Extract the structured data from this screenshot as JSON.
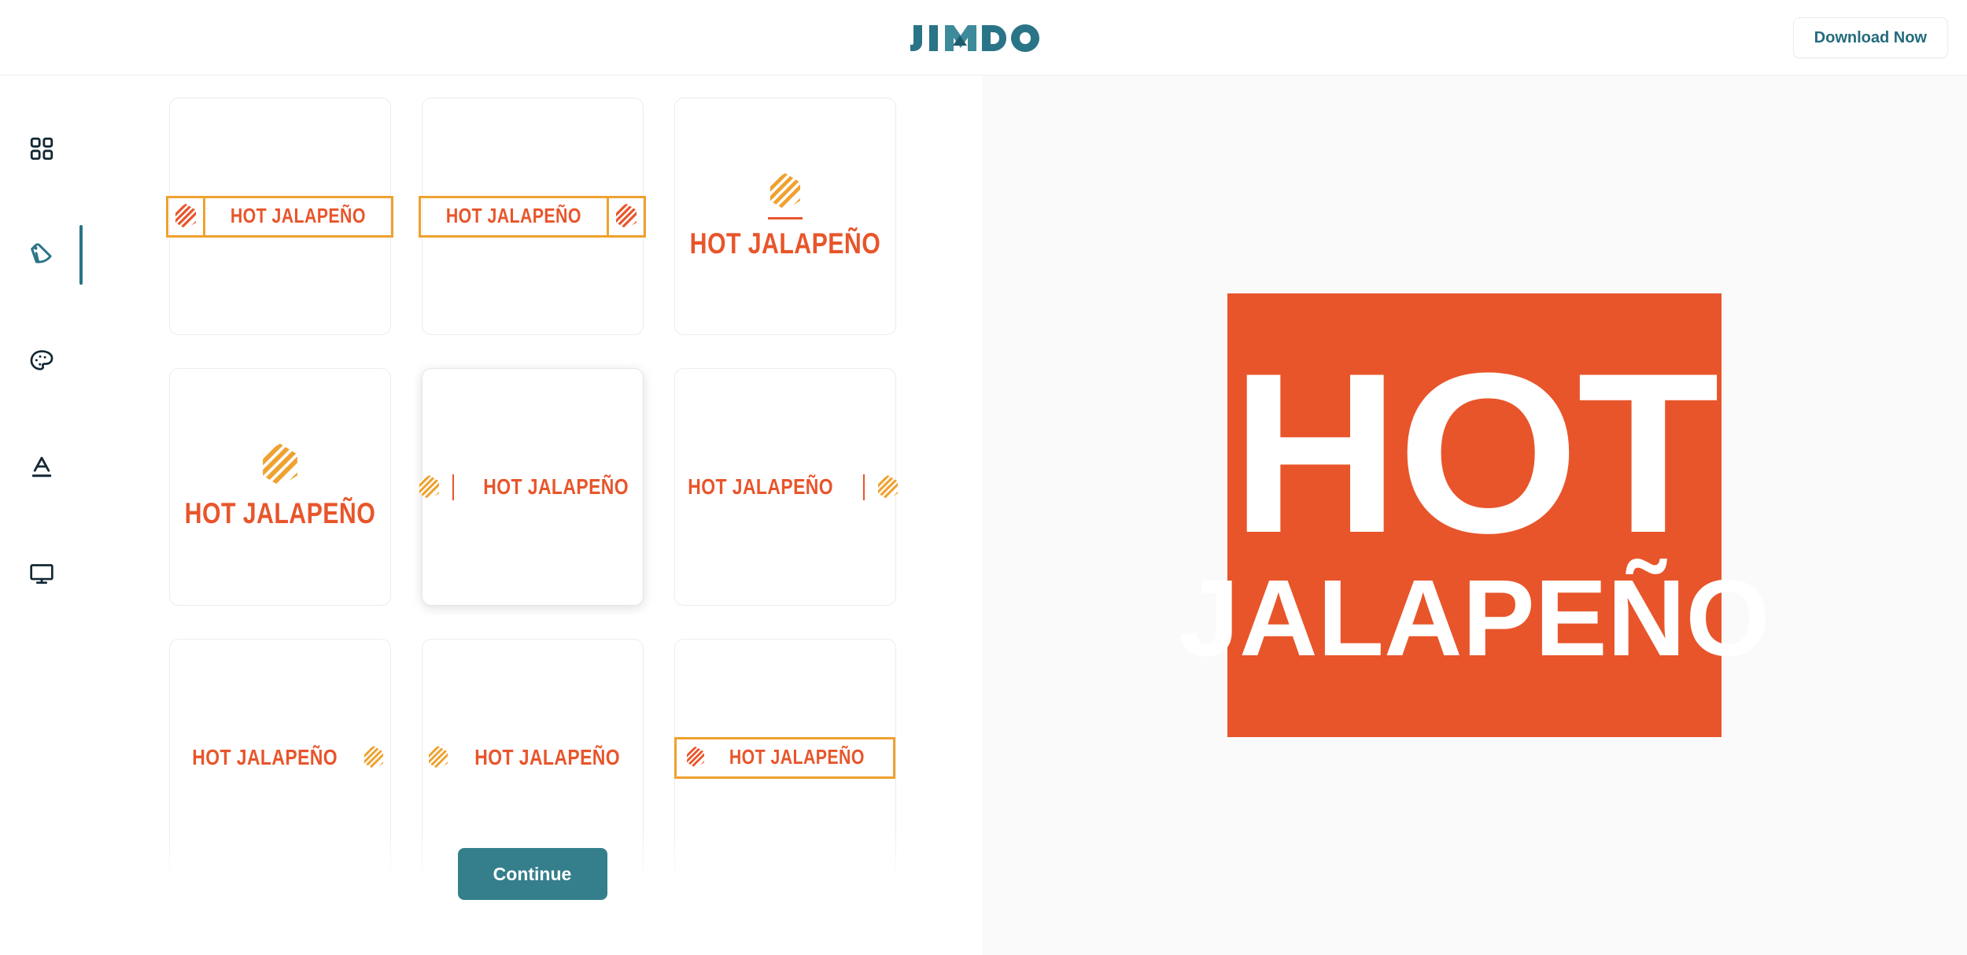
{
  "header": {
    "brand": "JIMDO",
    "brand_color": "#2a7487",
    "download_label": "Download Now"
  },
  "sidebar": {
    "items": [
      {
        "name": "templates",
        "icon": "grid-icon",
        "active": false
      },
      {
        "name": "logo",
        "icon": "tag-icon",
        "active": true
      },
      {
        "name": "colors",
        "icon": "palette-icon",
        "active": false
      },
      {
        "name": "fonts",
        "icon": "text-format-icon",
        "active": false
      },
      {
        "name": "preview",
        "icon": "monitor-icon",
        "active": false
      }
    ],
    "active_indicator_color": "#2a7487"
  },
  "picker": {
    "brand_name": "HOT JALAPEÑO",
    "text_color": "#E8552B",
    "accent_color": "#EFA12F",
    "cards": [
      {
        "id": 1,
        "layout": "boxed-icon-left",
        "label": "HOT JALAPEÑO",
        "selected": false
      },
      {
        "id": 2,
        "layout": "boxed-icon-right",
        "label": "HOT JALAPEÑO",
        "selected": false
      },
      {
        "id": 3,
        "layout": "stacked-icon-top",
        "label": "HOT JALAPEÑO",
        "selected": false
      },
      {
        "id": 4,
        "layout": "stacked-icon-top",
        "label": "HOT JALAPEÑO",
        "selected": false
      },
      {
        "id": 5,
        "layout": "inline-icon-left-rule",
        "label": "HOT JALAPEÑO",
        "selected": true
      },
      {
        "id": 6,
        "layout": "inline-icon-right-rule",
        "label": "HOT JALAPEÑO",
        "selected": false
      },
      {
        "id": 7,
        "layout": "plain-icon-right",
        "label": "HOT JALAPEÑO",
        "selected": false
      },
      {
        "id": 8,
        "layout": "plain-icon-left",
        "label": "HOT JALAPEÑO",
        "selected": false
      },
      {
        "id": 9,
        "layout": "boxed-single",
        "label": "HOT JALAPEÑO",
        "selected": false
      }
    ],
    "continue_label": "Continue"
  },
  "preview": {
    "line1": "HOT",
    "line2": "JALAPEÑO",
    "background_color": "#E8552B",
    "text_color": "#FFFFFF"
  }
}
